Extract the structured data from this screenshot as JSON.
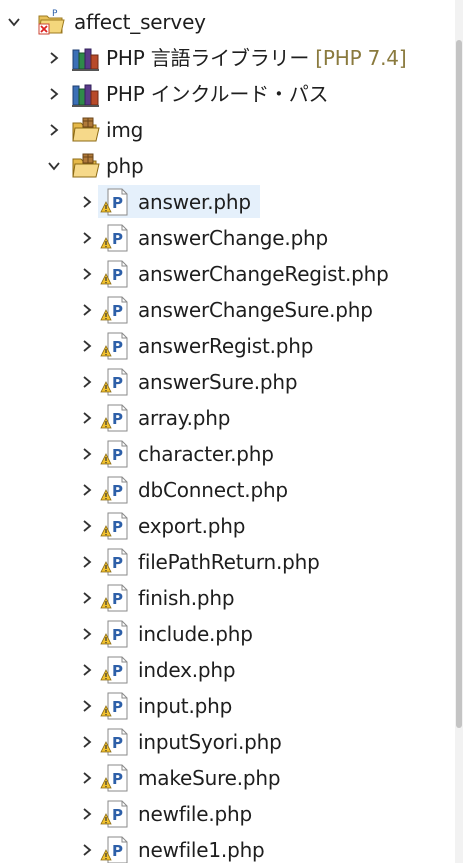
{
  "project": {
    "name": "affect_servey",
    "expanded": true,
    "icon": "php-project-icon"
  },
  "libraries": [
    {
      "name": "PHP 言語ライブラリー",
      "version": "[PHP 7.4]",
      "icon": "library-icon"
    },
    {
      "name": "PHP インクルード・パス",
      "icon": "library-icon"
    }
  ],
  "folders": [
    {
      "name": "img",
      "expanded": false,
      "icon": "folder-icon"
    },
    {
      "name": "php",
      "expanded": true,
      "icon": "package-folder-icon"
    }
  ],
  "files": [
    {
      "name": "answer.php",
      "selected": true
    },
    {
      "name": "answerChange.php"
    },
    {
      "name": "answerChangeRegist.php"
    },
    {
      "name": "answerChangeSure.php"
    },
    {
      "name": "answerRegist.php"
    },
    {
      "name": "answerSure.php"
    },
    {
      "name": "array.php"
    },
    {
      "name": "character.php"
    },
    {
      "name": "dbConnect.php"
    },
    {
      "name": "export.php"
    },
    {
      "name": "filePathReturn.php"
    },
    {
      "name": "finish.php"
    },
    {
      "name": "include.php"
    },
    {
      "name": "index.php"
    },
    {
      "name": "input.php"
    },
    {
      "name": "inputSyori.php"
    },
    {
      "name": "makeSure.php"
    },
    {
      "name": "newfile.php"
    },
    {
      "name": "newfile1.php"
    }
  ],
  "file_icon": "php-file-warning-icon",
  "colors": {
    "selection": "#e5f0fb",
    "version_text": "#8a7a3e",
    "php_file_blue": "#2d5fa8",
    "warning_yellow": "#f2c230"
  }
}
